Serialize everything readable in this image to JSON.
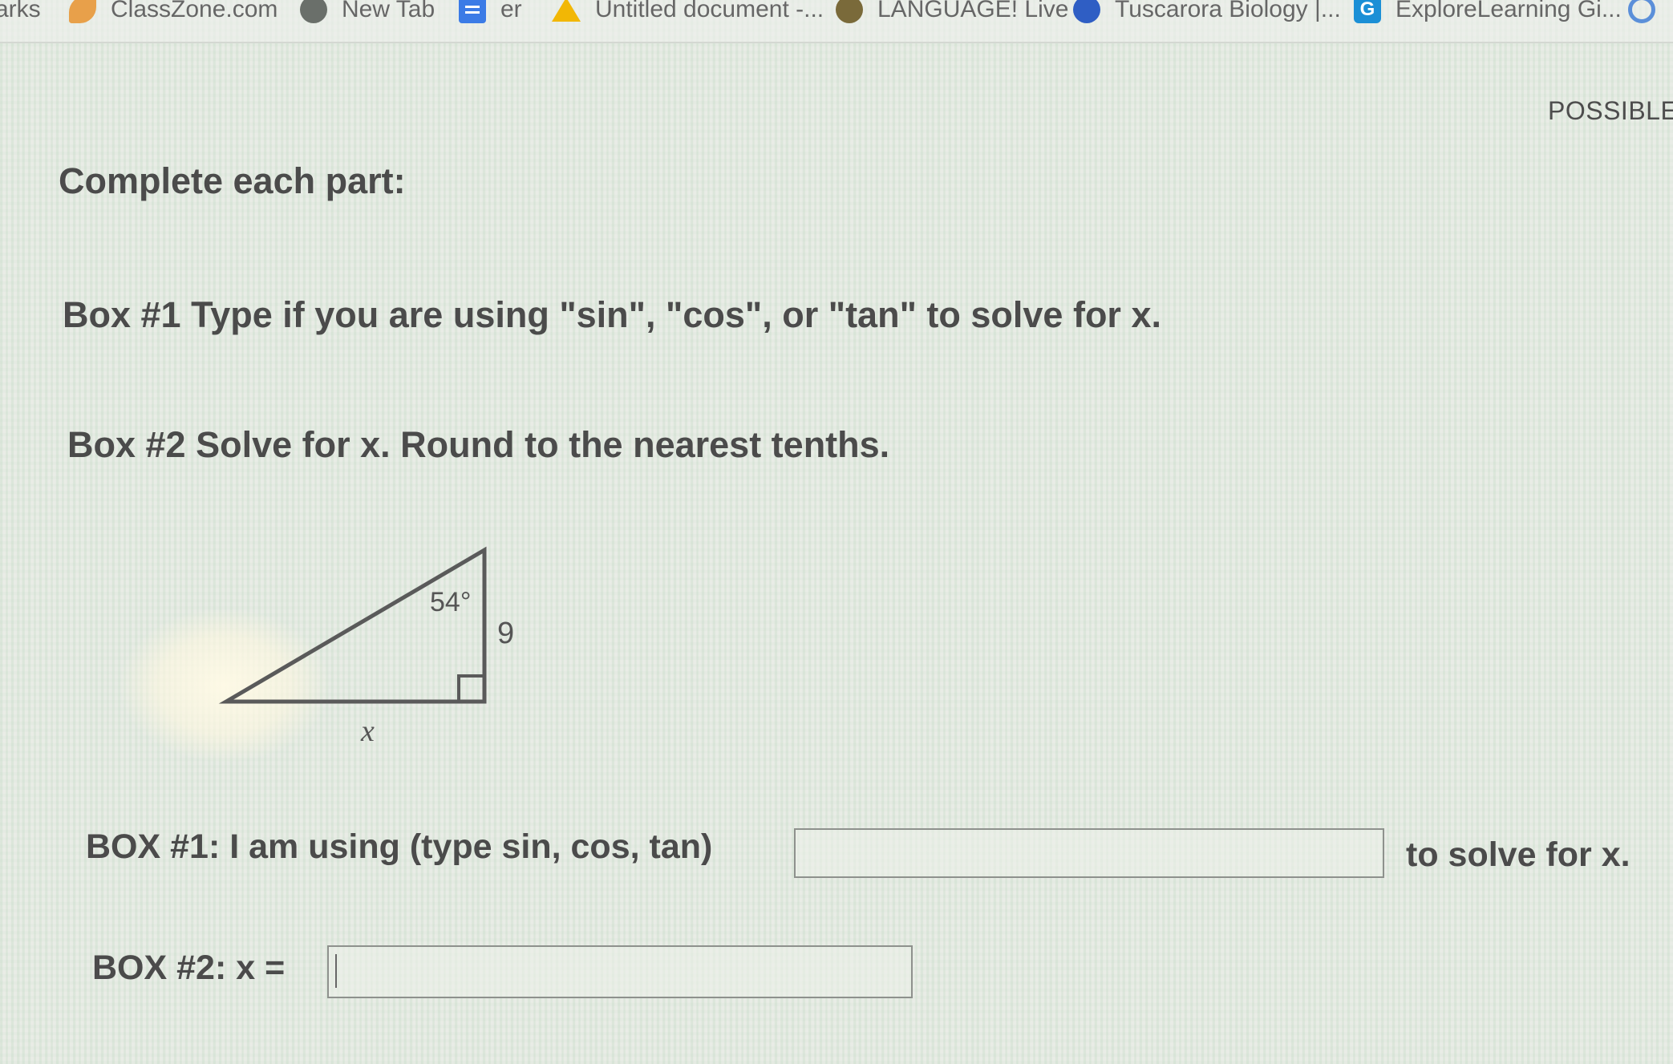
{
  "bookmarks": [
    {
      "label": "arks",
      "icon": "bookmark-icon"
    },
    {
      "label": "ClassZone.com",
      "icon": "leaf-icon"
    },
    {
      "label": "New Tab",
      "icon": "globe-icon"
    },
    {
      "label": "er",
      "icon": "docs-icon"
    },
    {
      "label": "Untitled document -...",
      "icon": "drive-icon"
    },
    {
      "label": "LANGUAGE! Live",
      "icon": "language-live-icon"
    },
    {
      "label": "Tuscarora Biology |...",
      "icon": "quizlet-icon"
    },
    {
      "label": "ExploreLearning Gi...",
      "icon": "explorelearning-icon"
    },
    {
      "label": "",
      "icon": "s-logo-icon"
    }
  ],
  "header": {
    "points_label": "POSSIBLE"
  },
  "instructions": {
    "heading": "Complete each part:",
    "line1": "Box #1 Type if you are using  \"sin\", \"cos\", or \"tan\" to solve for x.",
    "line2": "Box #2 Solve for x. Round to the nearest tenths."
  },
  "figure": {
    "angle_label": "54°",
    "side_label": "9",
    "base_label": "x"
  },
  "box1": {
    "prefix": "BOX #1: I am using  (type sin, cos, tan)",
    "value": "",
    "suffix": "to solve for x."
  },
  "box2": {
    "prefix": "BOX #2: x =",
    "value": ""
  }
}
